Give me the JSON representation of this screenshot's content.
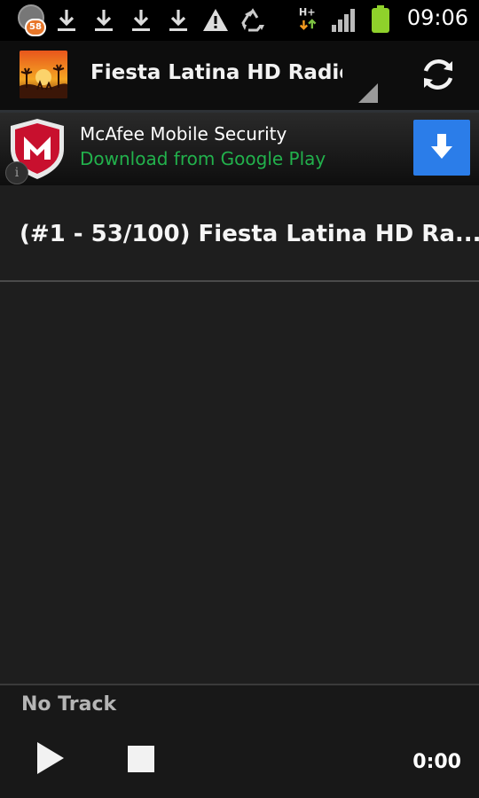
{
  "status_bar": {
    "notification_badge": "58",
    "time": "09:06",
    "icons": [
      "download-icon",
      "download-icon",
      "download-icon",
      "download-icon",
      "warning-icon",
      "recycle-icon",
      "h-plus-data-icon",
      "signal-icon",
      "battery-icon"
    ],
    "battery_color": "#8fd12b"
  },
  "action_bar": {
    "title": "Fiesta Latina HD Radio N"
  },
  "ad": {
    "title": "McAfee Mobile Security",
    "subtitle": "Download from Google Play",
    "info": "i",
    "subtitle_color": "#22b14c",
    "button_color": "#2b7de9"
  },
  "stations": [
    {
      "label": "(#1 - 53/100) Fiesta Latina HD Ra..."
    }
  ],
  "player": {
    "track": "No Track",
    "time": "0:00"
  }
}
